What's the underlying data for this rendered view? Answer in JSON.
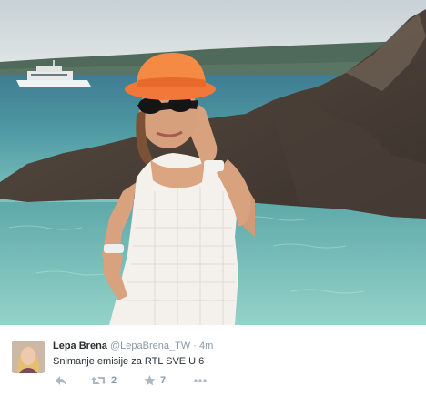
{
  "tweet": {
    "name": "Lepa Brena",
    "handle": "@LepaBrena_TW",
    "separator": "·",
    "time": "4m",
    "text": "Snimanje emisije za RTL  SVE U 6",
    "retweets": "2",
    "favorites": "7"
  },
  "icons": {
    "reply": "reply-icon",
    "retweet": "retweet-icon",
    "favorite": "star-icon",
    "more": "more-dots-icon"
  },
  "colors": {
    "text": "#292f33",
    "muted": "#8899a6",
    "icon": "#aab8c2"
  }
}
